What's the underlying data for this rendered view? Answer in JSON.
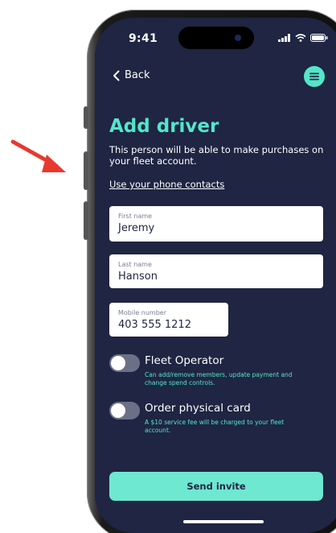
{
  "status_bar": {
    "time": "9:41",
    "icons": [
      "signal-icon",
      "wifi-icon",
      "battery-icon"
    ]
  },
  "nav": {
    "back_label": "Back",
    "menu_icon": "menu-icon"
  },
  "page": {
    "title": "Add driver",
    "subtitle": "This person will be able to make purchases on your fleet account.",
    "contacts_link": "Use your phone contacts"
  },
  "form": {
    "first_name": {
      "label": "First name",
      "value": "Jeremy"
    },
    "last_name": {
      "label": "Last name",
      "value": "Hanson"
    },
    "mobile": {
      "label": "Mobile number",
      "value": "403 555 1212"
    }
  },
  "toggles": [
    {
      "title": "Fleet Operator",
      "description": "Can add/remove members, update payment and change spend controls.",
      "on": false
    },
    {
      "title": "Order physical card",
      "description": "A $10 service fee will be charged to your fleet account.",
      "on": false
    }
  ],
  "actions": {
    "send_label": "Send invite"
  },
  "colors": {
    "background": "#1f2542",
    "accent": "#54e6c9",
    "button": "#6ee8d1",
    "arrow": "#e8392f"
  }
}
